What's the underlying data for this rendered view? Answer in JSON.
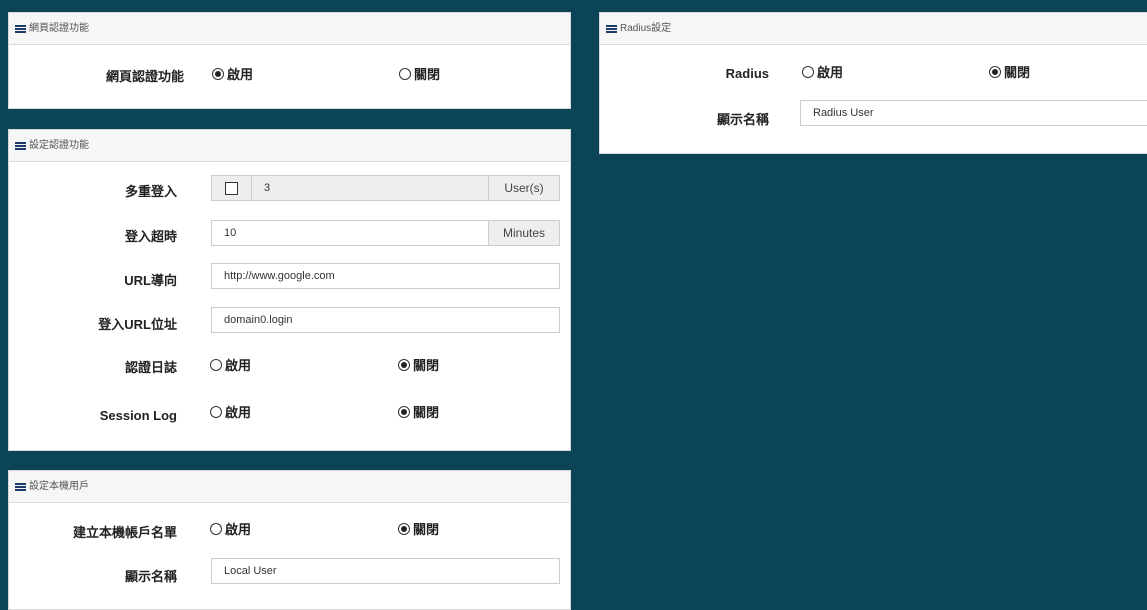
{
  "web_auth": {
    "title": "網頁認證功能",
    "label": "網頁認證功能",
    "enable": "啟用",
    "disable": "關閉",
    "selected": "enable"
  },
  "auth_settings": {
    "title": "設定認證功能",
    "multi_login": {
      "label": "多重登入",
      "value": "3",
      "unit": "User(s)",
      "checked": false
    },
    "login_timeout": {
      "label": "登入超時",
      "value": "10",
      "unit": "Minutes"
    },
    "url_redirect": {
      "label": "URL導向",
      "value": "http://www.google.com"
    },
    "login_url": {
      "label": "登入URL位址",
      "value": "domain0.login"
    },
    "auth_log": {
      "label": "認證日誌",
      "enable": "啟用",
      "disable": "關閉",
      "selected": "disable"
    },
    "session_log": {
      "label": "Session Log",
      "enable": "啟用",
      "disable": "關閉",
      "selected": "disable"
    }
  },
  "local_user": {
    "title": "設定本機用戶",
    "create_list": {
      "label": "建立本機帳戶名單",
      "enable": "啟用",
      "disable": "關閉",
      "selected": "disable"
    },
    "display_name": {
      "label": "顯示名稱",
      "value": "Local User"
    }
  },
  "radius": {
    "title": "Radius設定",
    "radius": {
      "label": "Radius",
      "enable": "啟用",
      "disable": "關閉",
      "selected": "disable"
    },
    "display_name": {
      "label": "顯示名稱",
      "value": "Radius User"
    }
  }
}
